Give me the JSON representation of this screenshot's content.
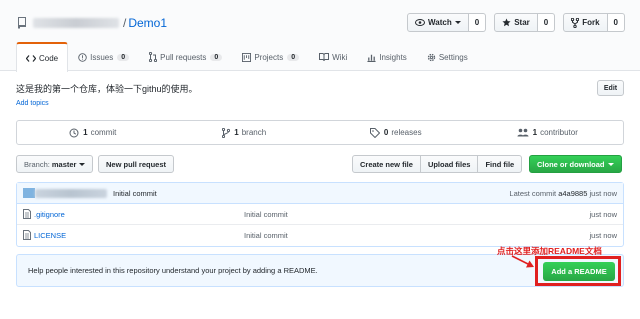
{
  "repo": {
    "name": "Demo1",
    "separator": "/"
  },
  "actions": [
    {
      "label": "Watch",
      "count": "0",
      "icon": "eye-icon"
    },
    {
      "label": "Star",
      "count": "0",
      "icon": "star-icon"
    },
    {
      "label": "Fork",
      "count": "0",
      "icon": "fork-icon"
    }
  ],
  "tabs": [
    {
      "label": "Code",
      "count": null,
      "selected": true
    },
    {
      "label": "Issues",
      "count": "0"
    },
    {
      "label": "Pull requests",
      "count": "0"
    },
    {
      "label": "Projects",
      "count": "0"
    },
    {
      "label": "Wiki",
      "count": null
    },
    {
      "label": "Insights",
      "count": null
    },
    {
      "label": "Settings",
      "count": null
    }
  ],
  "description": "这是我的第一个仓库，体验一下githu的使用。",
  "add_topics": "Add topics",
  "edit_label": "Edit",
  "numbers": [
    {
      "value": "1",
      "label": "commit"
    },
    {
      "value": "1",
      "label": "branch"
    },
    {
      "value": "0",
      "label": "releases"
    },
    {
      "value": "1",
      "label": "contributor"
    }
  ],
  "file_nav": {
    "branch_prefix": "Branch:",
    "branch_name": "master",
    "new_pr": "New pull request",
    "create_file": "Create new file",
    "upload_files": "Upload files",
    "find_file": "Find file",
    "clone": "Clone or download"
  },
  "commit_tease": {
    "message": "Initial commit",
    "latest_prefix": "Latest commit",
    "sha": "a4a9885",
    "age": "just now"
  },
  "files": [
    {
      "name": ".gitignore",
      "message": "Initial commit",
      "age": "just now"
    },
    {
      "name": "LICENSE",
      "message": "Initial commit",
      "age": "just now"
    }
  ],
  "readme": {
    "text": "Help people interested in this repository understand your project by adding a README.",
    "button": "Add a README"
  },
  "annotation": "点击这里添加README文档",
  "colors": {
    "accent_tab": "#e36209",
    "link": "#0366d6",
    "green": "#28a745",
    "annotation": "#e02020"
  }
}
